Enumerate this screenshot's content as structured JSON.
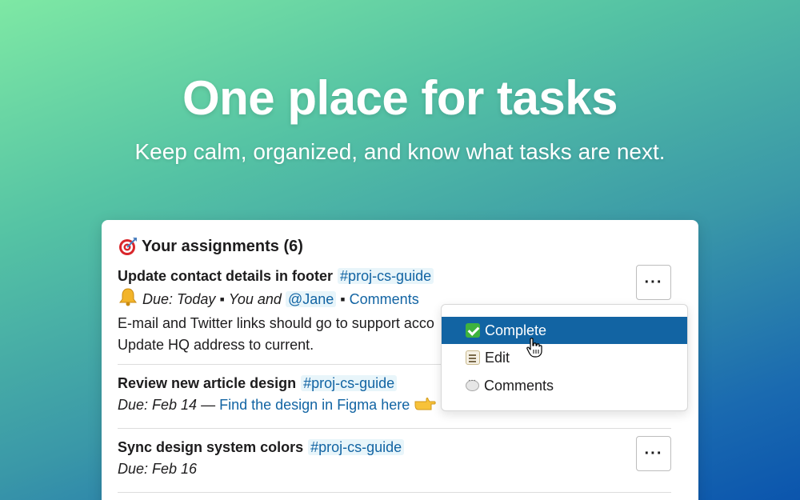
{
  "hero": {
    "title": "One place for tasks",
    "subtitle": "Keep calm, organized, and know what tasks are next."
  },
  "card": {
    "title": "Your assignments (6)",
    "tasks": [
      {
        "title": "Update contact details in footer",
        "channel": "#proj-cs-guide",
        "meta_due": "Due: Today",
        "meta_sep1": "▪",
        "meta_people": "You and",
        "mention": "@Jane",
        "meta_sep2": "▪",
        "comments_link": "Comments",
        "desc_line1": "E-mail and Twitter links should go to support acco",
        "desc_line2": "Update HQ address to current."
      },
      {
        "title": "Review new article design",
        "channel": "#proj-cs-guide",
        "meta_due": "Due: Feb 14",
        "meta_dash": "—",
        "link": "Find the design in Figma here"
      },
      {
        "title": "Sync design system colors",
        "channel": "#proj-cs-guide",
        "meta_due": "Due: Feb 16"
      }
    ],
    "more_label": "···"
  },
  "menu": {
    "items": [
      {
        "label": "Complete",
        "icon": "check-mark-icon",
        "active": true
      },
      {
        "label": "Edit",
        "icon": "memo-icon",
        "active": false
      },
      {
        "label": "Comments",
        "icon": "speech-bubble-icon",
        "active": false
      }
    ]
  },
  "colors": {
    "link": "#1264a3",
    "menu_active": "#1264a3",
    "text": "#1d1c1d"
  }
}
